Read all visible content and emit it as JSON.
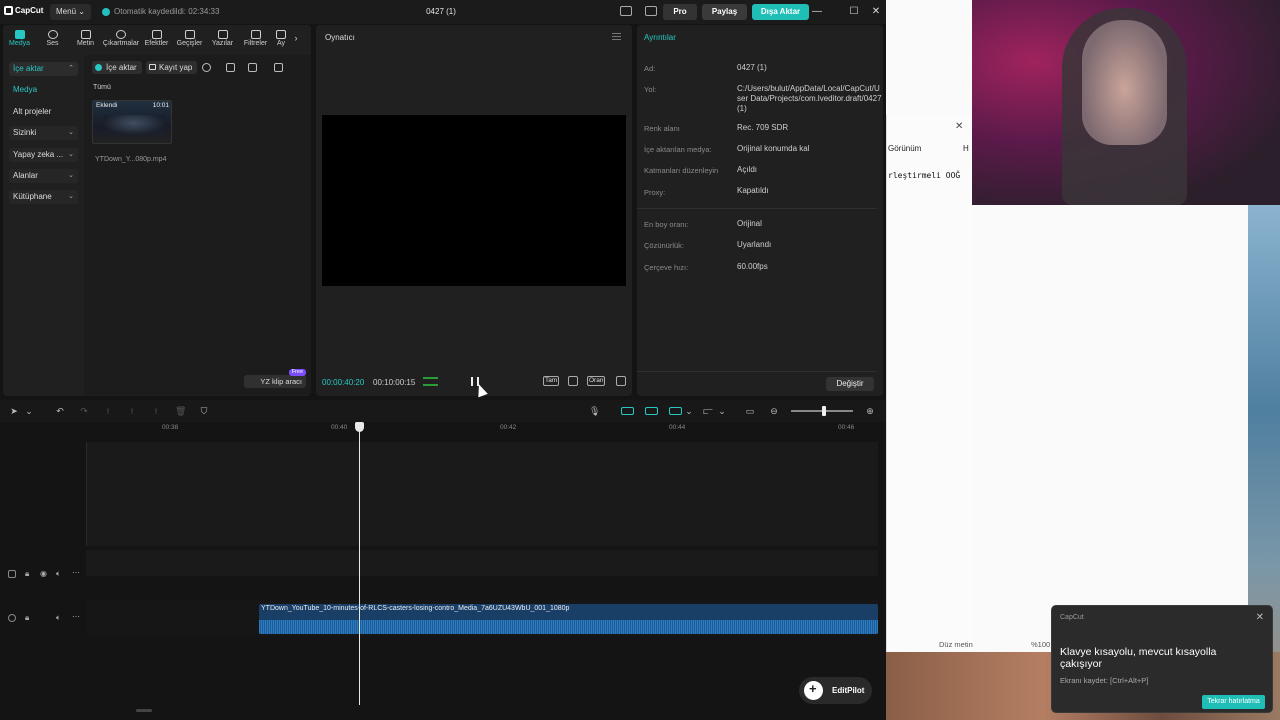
{
  "titlebar": {
    "logo": "CapCut",
    "menu": "Menü",
    "autosave": "Otomatik kaydedildi: 02:34:33",
    "title": "0427 (1)",
    "pro": "Pro",
    "share": "Paylaş",
    "export": "Dışa Aktar"
  },
  "tabs": [
    {
      "label": "Medya",
      "icon": "media-icon"
    },
    {
      "label": "Ses",
      "icon": "audio-icon"
    },
    {
      "label": "Metin",
      "icon": "text-icon"
    },
    {
      "label": "Çıkartmalar",
      "icon": "sticker-icon"
    },
    {
      "label": "Efektler",
      "icon": "effects-icon"
    },
    {
      "label": "Geçişler",
      "icon": "transition-icon"
    },
    {
      "label": "Yazılar",
      "icon": "caption-icon"
    },
    {
      "label": "Filtreler",
      "icon": "filter-icon"
    },
    {
      "label": "Ay",
      "icon": "adjust-icon"
    }
  ],
  "sidenav": {
    "import": "İçe aktar",
    "media": "Medya",
    "subprojects": "Alt projeler",
    "yours": "Sizinki",
    "ai": "Yapay zeka ...",
    "spaces": "Alanlar",
    "library": "Kütüphane"
  },
  "media": {
    "import_btn": "İçe aktar",
    "record_btn": "Kayıt yap",
    "filter_all": "Tümü",
    "thumb_added": "Eklendi",
    "thumb_duration": "10:01",
    "thumb_name": "YTDown_Y...080p.mp4",
    "ai_clip_btn": "YZ klip aracı",
    "ai_clip_badge": "Free"
  },
  "player": {
    "title": "Oynatıcı",
    "current_time": "00:00:40:20",
    "total_time": "00:10:00:15",
    "full_btn": "Tam",
    "ratio_btn": "Oran"
  },
  "details": {
    "title": "Ayrıntılar",
    "rows": [
      {
        "label": "Ad:",
        "value": "0427 (1)"
      },
      {
        "label": "Yol:",
        "value": "C:/Users/bulut/AppData/Local/CapCut/User Data/Projects/com.lveditor.draft/0427 (1)"
      },
      {
        "label": "Renk alanı",
        "value": "Rec. 709 SDR"
      },
      {
        "label": "İçe aktarılan medya:",
        "value": "Orijinal konumda kal"
      },
      {
        "label": "Katmanları düzenleyin",
        "value": "Açıldı"
      },
      {
        "label": "Proxy:",
        "value": "Kapatıldı"
      },
      {
        "label": "En boy oranı:",
        "value": "Orijinal"
      },
      {
        "label": "Çözünürlük:",
        "value": "Uyarlandı"
      },
      {
        "label": "Çerçeve hızı:",
        "value": "60.00fps"
      }
    ],
    "modify_btn": "Değiştir"
  },
  "timeline": {
    "ticks": [
      "00:38",
      "00:40",
      "00:42",
      "00:44",
      "00:46"
    ],
    "clip_name": "YTDown_YouTube_10-minutes-of-RLCS-casters-losing-contro_Media_7a6UZU43WbU_001_1080p",
    "editpilot": "EditPilot"
  },
  "notepad": {
    "view_menu": "Görünüm",
    "h_menu": "H",
    "text": "rleştirmeli OOĞ",
    "status_mode": "Düz metin",
    "status_zoom": "%100"
  },
  "notification": {
    "app": "CapCut",
    "title": "Klavye kısayolu, mevcut kısayolla çakışıyor",
    "subtitle": "Ekranı kaydet: [Ctrl+Alt+P]",
    "button": "Tekrar hatırlatma"
  }
}
